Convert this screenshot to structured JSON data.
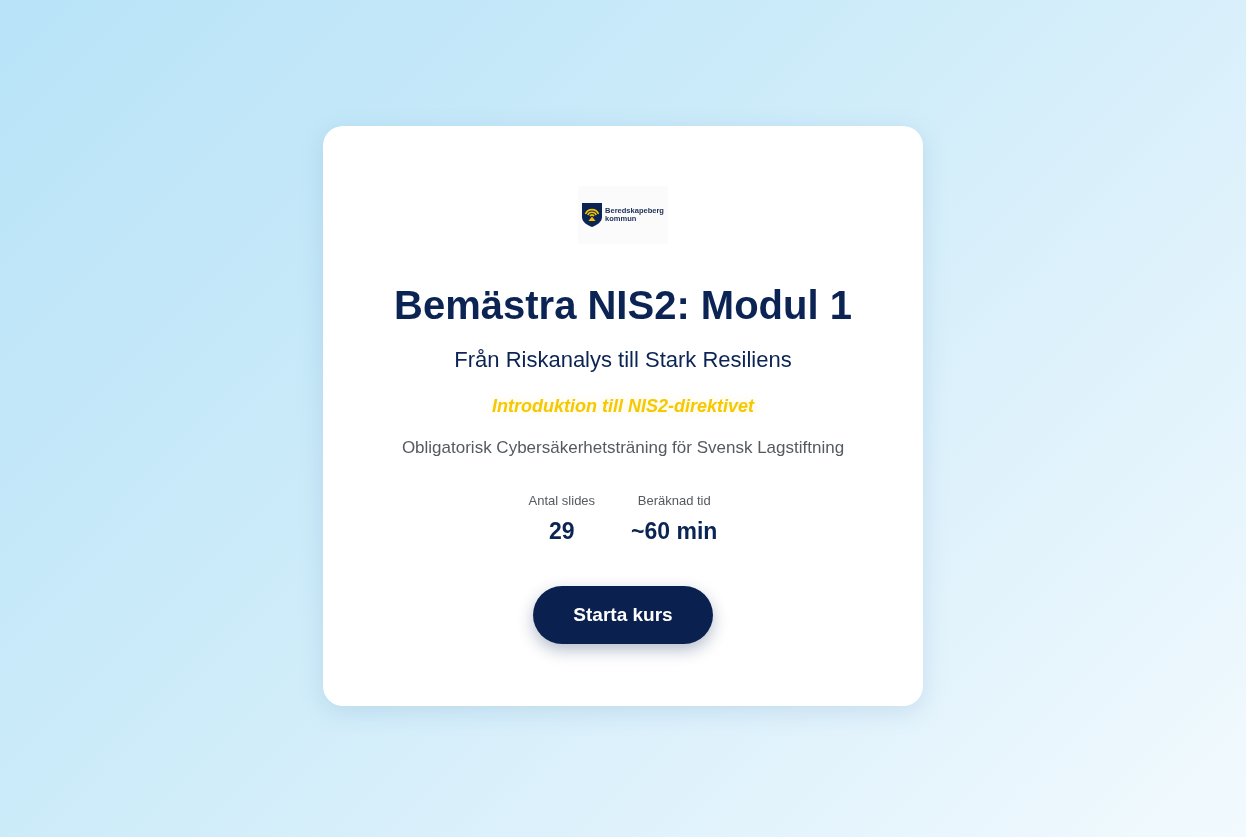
{
  "logo": {
    "name": "Beredskapeberg",
    "subname": "kommun"
  },
  "title": "Bemästra NIS2: Modul 1",
  "subtitle": "Från Riskanalys till Stark Resiliens",
  "tagline": "Introduktion till NIS2-direktivet",
  "description": "Obligatorisk Cybersäkerhetsträning för Svensk Lagstiftning",
  "stats": [
    {
      "label": "Antal slides",
      "value": "29"
    },
    {
      "label": "Beräknad tid",
      "value": "~60 min"
    }
  ],
  "button": {
    "label": "Starta kurs"
  }
}
